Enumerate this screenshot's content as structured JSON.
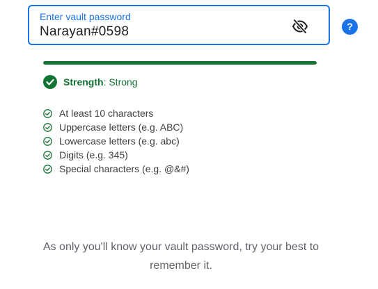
{
  "password_field": {
    "label": "Enter vault password",
    "value": "Narayan#0598",
    "toggle_icon": "eye-off-icon"
  },
  "help_button": {
    "label": "?",
    "icon": "help-icon"
  },
  "strength": {
    "key": "Strength",
    "separator": ": ",
    "value": "Strong",
    "progress": 1.0,
    "color": "#137333"
  },
  "requirements": [
    {
      "label": "At least 10 characters",
      "met": true
    },
    {
      "label": "Uppercase letters (e.g. ABC)",
      "met": true
    },
    {
      "label": "Lowercase letters (e.g. abc)",
      "met": true
    },
    {
      "label": "Digits (e.g. 345)",
      "met": true
    },
    {
      "label": "Special characters (e.g. @&#)",
      "met": true
    }
  ],
  "hint": "As only you'll know your vault password, try your best to remember it.",
  "colors": {
    "accent": "#1a73e8",
    "success": "#137333"
  }
}
